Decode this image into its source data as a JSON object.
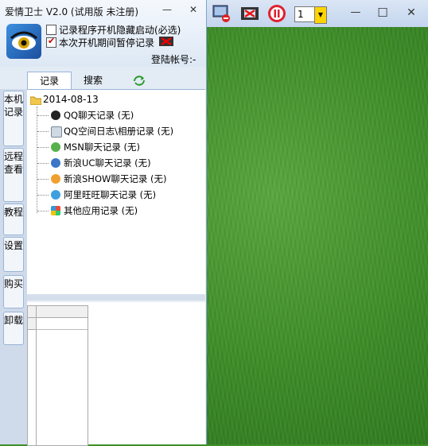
{
  "app": {
    "title": "爱情卫士 V2.0 (试用版 未注册)",
    "minimize_symbol": "—",
    "close_symbol": "✕"
  },
  "options": {
    "hide_on_boot_label": "记录程序开机隐藏启动(必选)",
    "hide_on_boot_checked": false,
    "pause_label": "本次开机期间暂停记录",
    "pause_checked": true,
    "account_label": "登陆帐号:-"
  },
  "tabs": [
    {
      "label": "记录"
    },
    {
      "label": "搜索"
    },
    {
      "label": "",
      "icon": "refresh-icon"
    }
  ],
  "sidebar": {
    "items": [
      {
        "label": "本机记录"
      },
      {
        "label": "远程查看"
      },
      {
        "label": "教程"
      },
      {
        "label": "设置"
      },
      {
        "label": "购买"
      },
      {
        "label": "卸载"
      }
    ]
  },
  "tree": {
    "root": "2014-08-13",
    "items": [
      {
        "label": "QQ聊天记录 (无)",
        "icon": "qq-icon"
      },
      {
        "label": "QQ空间日志\\相册记录 (无)",
        "icon": "qzone-icon"
      },
      {
        "label": "MSN聊天记录 (无)",
        "icon": "msn-icon"
      },
      {
        "label": "新浪UC聊天记录 (无)",
        "icon": "uc-icon"
      },
      {
        "label": "新浪SHOW聊天记录 (无)",
        "icon": "show-icon"
      },
      {
        "label": "阿里旺旺聊天记录 (无)",
        "icon": "wangwang-icon"
      },
      {
        "label": "其他应用记录 (无)",
        "icon": "windows-icon"
      }
    ]
  },
  "viewer": {
    "page_value": "1",
    "window_minimize": "—",
    "window_maximize": "☐",
    "window_close": "✕"
  }
}
